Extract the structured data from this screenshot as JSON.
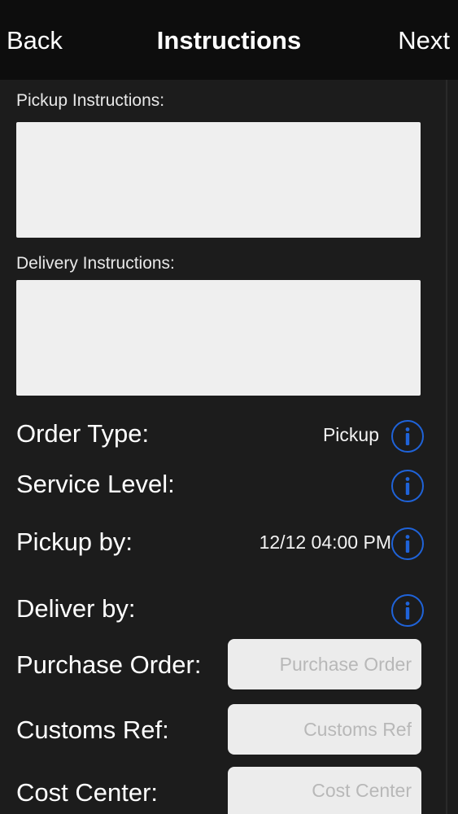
{
  "navbar": {
    "back_label": "Back",
    "title": "Instructions",
    "next_label": "Next"
  },
  "pickup_instructions": {
    "label": "Pickup Instructions:",
    "value": ""
  },
  "delivery_instructions": {
    "label": "Delivery Instructions:",
    "value": ""
  },
  "rows": {
    "order_type": {
      "label": "Order Type:",
      "value": "Pickup"
    },
    "service_level": {
      "label": "Service Level:",
      "value": ""
    },
    "pickup_by": {
      "label": "Pickup by:",
      "value": "12/12 04:00 PM"
    },
    "deliver_by": {
      "label": "Deliver by:",
      "value": ""
    }
  },
  "fields": {
    "purchase_order": {
      "label": "Purchase Order:",
      "placeholder": "Purchase Order",
      "value": ""
    },
    "customs_ref": {
      "label": "Customs Ref:",
      "placeholder": "Customs Ref",
      "value": ""
    },
    "cost_center": {
      "label": "Cost Center:",
      "placeholder": "Cost Center",
      "value": ""
    }
  },
  "icons": {
    "info": "info-circle-icon"
  },
  "colors": {
    "background": "#1c1c1c",
    "navbar": "#0d0d0d",
    "accent": "#1f63d9",
    "field": "#ececec"
  }
}
